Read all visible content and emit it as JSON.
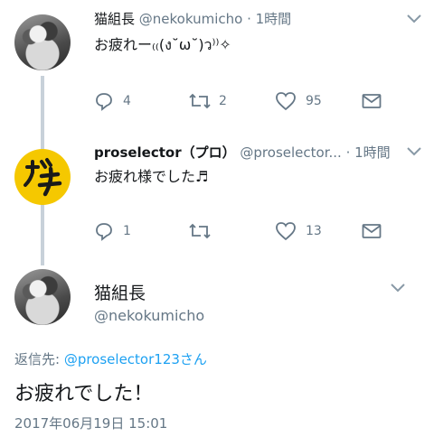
{
  "tweet1": {
    "name": "猫組長",
    "handle": "@nekokumicho",
    "time": "· 1時間",
    "text": "お疲れー₍₍(ง˘ω˘)ว⁾⁾✧",
    "replies": "4",
    "retweets": "2",
    "likes": "95"
  },
  "tweet2": {
    "name": "proselector（プロ）",
    "handle": "@proselector...",
    "time": "· 1時間",
    "text": "お疲れ様でした♬",
    "replies": "1",
    "retweets": "",
    "likes": "13"
  },
  "focus": {
    "name": "猫組長",
    "handle": "@nekokumicho",
    "reply_label": "返信先: ",
    "reply_mention": "@proselector123さん",
    "text": "お疲れでした！",
    "timestamp": "2017年06月19日 15:01"
  },
  "colors": {
    "accent": "#1da1f2",
    "muted": "#657786",
    "thread_line": "#c8d1d9",
    "gachi_bg": "#f5c800"
  }
}
